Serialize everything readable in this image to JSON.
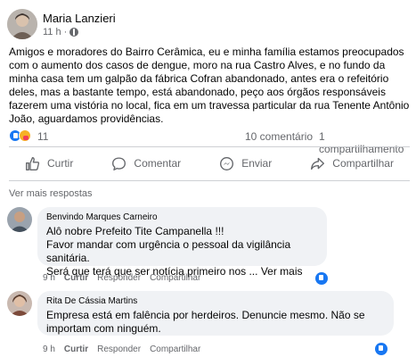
{
  "post": {
    "author": "Maria Lanzieri",
    "time": "11 h",
    "text": "Amigos e moradores do Bairro Cerâmica, eu e minha família estamos preocupados com o aumento dos casos de dengue, moro na rua Castro Alves, e no fundo da minha casa tem um galpão da fábrica Cofran abandonado, antes era o refeitório deles, mas a bastante tempo, está abandonado, peço aos órgãos responsáveis fazerem uma vistória no local, fica em um travessa particular da rua Tenente Antônio João, aguardamos providências.",
    "reaction_count": "11",
    "comment_count": "10 comentário",
    "share_count": "1 compartilhamento"
  },
  "actions": {
    "like": "Curtir",
    "comment": "Comentar",
    "send": "Enviar",
    "share": "Compartilhar"
  },
  "more_replies": "Ver mais respostas",
  "comments": [
    {
      "author": "Benvindo Marques Carneiro",
      "lines": [
        "Alô nobre Prefeito Tite Campanella !!!",
        "Favor mandar com urgência o pessoal da vigilância sanitária.",
        "Será que terá que ser notícia primeiro nos ..."
      ],
      "see_more": "Ver mais",
      "time": "9 h",
      "like": "Curtir",
      "reply": "Responder",
      "share": "Compartilhar"
    },
    {
      "author": "Rita De Cássia Martins",
      "lines": [
        "Empresa está em falência por herdeiros. Denuncie mesmo. Não se",
        "importam com ninguém."
      ],
      "time": "9 h",
      "like": "Curtir",
      "reply": "Responder",
      "share": "Compartilhar"
    }
  ],
  "colors": {
    "accent": "#1877f2",
    "secondary_text": "#65676b",
    "bubble": "#f0f2f5"
  }
}
